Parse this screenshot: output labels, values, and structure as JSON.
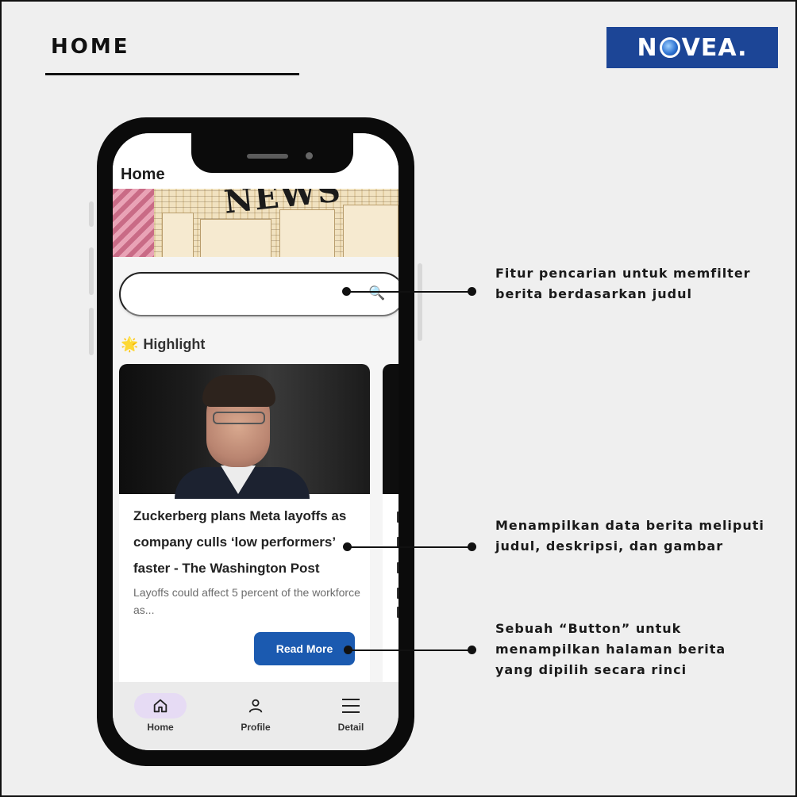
{
  "slide": {
    "title": "HOME",
    "logo_prefix": "N",
    "logo_suffix": "VEA."
  },
  "app": {
    "header_title": "Home",
    "search": {
      "placeholder": ""
    },
    "section_label": "Highlight",
    "article": {
      "title": "Zuckerberg plans Meta layoffs as company culls ‘low performers’ faster - The Washington Post",
      "description": "Layoffs could affect 5 percent of the workforce as...",
      "button_label": "Read More"
    },
    "nav": [
      {
        "label": "Home",
        "icon": "home-icon",
        "active": true
      },
      {
        "label": "Profile",
        "icon": "profile-icon",
        "active": false
      },
      {
        "label": "Detail",
        "icon": "menu-icon",
        "active": false
      }
    ]
  },
  "annotations": [
    {
      "text": "Fitur pencarian untuk memfilter berita berdasarkan judul"
    },
    {
      "text": "Menampilkan data berita meliputi judul, deskripsi, dan gambar"
    },
    {
      "text": "Sebuah “Button” untuk menampilkan halaman berita yang dipilih secara rinci"
    }
  ],
  "colors": {
    "logo_bg": "#1c4596",
    "button_bg": "#1b5ab0",
    "nav_active_pill": "#e6dbf4"
  }
}
